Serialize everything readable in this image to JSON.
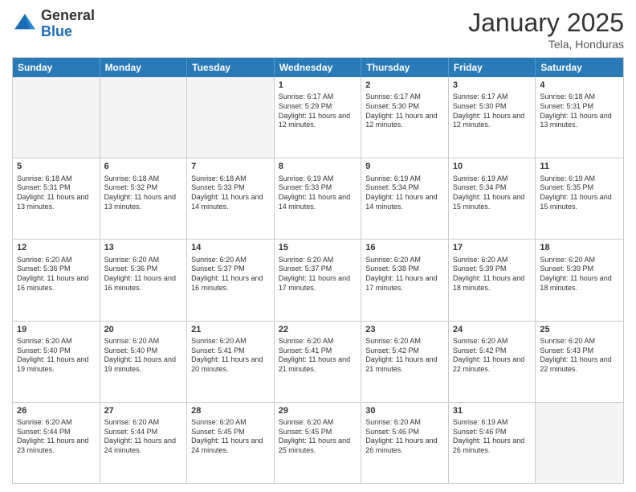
{
  "logo": {
    "general": "General",
    "blue": "Blue"
  },
  "title": "January 2025",
  "location": "Tela, Honduras",
  "days": [
    "Sunday",
    "Monday",
    "Tuesday",
    "Wednesday",
    "Thursday",
    "Friday",
    "Saturday"
  ],
  "weeks": [
    [
      {
        "day": "",
        "sunrise": "",
        "sunset": "",
        "daylight": "",
        "empty": true
      },
      {
        "day": "",
        "sunrise": "",
        "sunset": "",
        "daylight": "",
        "empty": true
      },
      {
        "day": "",
        "sunrise": "",
        "sunset": "",
        "daylight": "",
        "empty": true
      },
      {
        "day": "1",
        "sunrise": "Sunrise: 6:17 AM",
        "sunset": "Sunset: 5:29 PM",
        "daylight": "Daylight: 11 hours and 12 minutes.",
        "empty": false
      },
      {
        "day": "2",
        "sunrise": "Sunrise: 6:17 AM",
        "sunset": "Sunset: 5:30 PM",
        "daylight": "Daylight: 11 hours and 12 minutes.",
        "empty": false
      },
      {
        "day": "3",
        "sunrise": "Sunrise: 6:17 AM",
        "sunset": "Sunset: 5:30 PM",
        "daylight": "Daylight: 11 hours and 12 minutes.",
        "empty": false
      },
      {
        "day": "4",
        "sunrise": "Sunrise: 6:18 AM",
        "sunset": "Sunset: 5:31 PM",
        "daylight": "Daylight: 11 hours and 13 minutes.",
        "empty": false
      }
    ],
    [
      {
        "day": "5",
        "sunrise": "Sunrise: 6:18 AM",
        "sunset": "Sunset: 5:31 PM",
        "daylight": "Daylight: 11 hours and 13 minutes.",
        "empty": false
      },
      {
        "day": "6",
        "sunrise": "Sunrise: 6:18 AM",
        "sunset": "Sunset: 5:32 PM",
        "daylight": "Daylight: 11 hours and 13 minutes.",
        "empty": false
      },
      {
        "day": "7",
        "sunrise": "Sunrise: 6:18 AM",
        "sunset": "Sunset: 5:33 PM",
        "daylight": "Daylight: 11 hours and 14 minutes.",
        "empty": false
      },
      {
        "day": "8",
        "sunrise": "Sunrise: 6:19 AM",
        "sunset": "Sunset: 5:33 PM",
        "daylight": "Daylight: 11 hours and 14 minutes.",
        "empty": false
      },
      {
        "day": "9",
        "sunrise": "Sunrise: 6:19 AM",
        "sunset": "Sunset: 5:34 PM",
        "daylight": "Daylight: 11 hours and 14 minutes.",
        "empty": false
      },
      {
        "day": "10",
        "sunrise": "Sunrise: 6:19 AM",
        "sunset": "Sunset: 5:34 PM",
        "daylight": "Daylight: 11 hours and 15 minutes.",
        "empty": false
      },
      {
        "day": "11",
        "sunrise": "Sunrise: 6:19 AM",
        "sunset": "Sunset: 5:35 PM",
        "daylight": "Daylight: 11 hours and 15 minutes.",
        "empty": false
      }
    ],
    [
      {
        "day": "12",
        "sunrise": "Sunrise: 6:20 AM",
        "sunset": "Sunset: 5:36 PM",
        "daylight": "Daylight: 11 hours and 16 minutes.",
        "empty": false
      },
      {
        "day": "13",
        "sunrise": "Sunrise: 6:20 AM",
        "sunset": "Sunset: 5:36 PM",
        "daylight": "Daylight: 11 hours and 16 minutes.",
        "empty": false
      },
      {
        "day": "14",
        "sunrise": "Sunrise: 6:20 AM",
        "sunset": "Sunset: 5:37 PM",
        "daylight": "Daylight: 11 hours and 16 minutes.",
        "empty": false
      },
      {
        "day": "15",
        "sunrise": "Sunrise: 6:20 AM",
        "sunset": "Sunset: 5:37 PM",
        "daylight": "Daylight: 11 hours and 17 minutes.",
        "empty": false
      },
      {
        "day": "16",
        "sunrise": "Sunrise: 6:20 AM",
        "sunset": "Sunset: 5:38 PM",
        "daylight": "Daylight: 11 hours and 17 minutes.",
        "empty": false
      },
      {
        "day": "17",
        "sunrise": "Sunrise: 6:20 AM",
        "sunset": "Sunset: 5:39 PM",
        "daylight": "Daylight: 11 hours and 18 minutes.",
        "empty": false
      },
      {
        "day": "18",
        "sunrise": "Sunrise: 6:20 AM",
        "sunset": "Sunset: 5:39 PM",
        "daylight": "Daylight: 11 hours and 18 minutes.",
        "empty": false
      }
    ],
    [
      {
        "day": "19",
        "sunrise": "Sunrise: 6:20 AM",
        "sunset": "Sunset: 5:40 PM",
        "daylight": "Daylight: 11 hours and 19 minutes.",
        "empty": false
      },
      {
        "day": "20",
        "sunrise": "Sunrise: 6:20 AM",
        "sunset": "Sunset: 5:40 PM",
        "daylight": "Daylight: 11 hours and 19 minutes.",
        "empty": false
      },
      {
        "day": "21",
        "sunrise": "Sunrise: 6:20 AM",
        "sunset": "Sunset: 5:41 PM",
        "daylight": "Daylight: 11 hours and 20 minutes.",
        "empty": false
      },
      {
        "day": "22",
        "sunrise": "Sunrise: 6:20 AM",
        "sunset": "Sunset: 5:41 PM",
        "daylight": "Daylight: 11 hours and 21 minutes.",
        "empty": false
      },
      {
        "day": "23",
        "sunrise": "Sunrise: 6:20 AM",
        "sunset": "Sunset: 5:42 PM",
        "daylight": "Daylight: 11 hours and 21 minutes.",
        "empty": false
      },
      {
        "day": "24",
        "sunrise": "Sunrise: 6:20 AM",
        "sunset": "Sunset: 5:42 PM",
        "daylight": "Daylight: 11 hours and 22 minutes.",
        "empty": false
      },
      {
        "day": "25",
        "sunrise": "Sunrise: 6:20 AM",
        "sunset": "Sunset: 5:43 PM",
        "daylight": "Daylight: 11 hours and 22 minutes.",
        "empty": false
      }
    ],
    [
      {
        "day": "26",
        "sunrise": "Sunrise: 6:20 AM",
        "sunset": "Sunset: 5:44 PM",
        "daylight": "Daylight: 11 hours and 23 minutes.",
        "empty": false
      },
      {
        "day": "27",
        "sunrise": "Sunrise: 6:20 AM",
        "sunset": "Sunset: 5:44 PM",
        "daylight": "Daylight: 11 hours and 24 minutes.",
        "empty": false
      },
      {
        "day": "28",
        "sunrise": "Sunrise: 6:20 AM",
        "sunset": "Sunset: 5:45 PM",
        "daylight": "Daylight: 11 hours and 24 minutes.",
        "empty": false
      },
      {
        "day": "29",
        "sunrise": "Sunrise: 6:20 AM",
        "sunset": "Sunset: 5:45 PM",
        "daylight": "Daylight: 11 hours and 25 minutes.",
        "empty": false
      },
      {
        "day": "30",
        "sunrise": "Sunrise: 6:20 AM",
        "sunset": "Sunset: 5:46 PM",
        "daylight": "Daylight: 11 hours and 26 minutes.",
        "empty": false
      },
      {
        "day": "31",
        "sunrise": "Sunrise: 6:19 AM",
        "sunset": "Sunset: 5:46 PM",
        "daylight": "Daylight: 11 hours and 26 minutes.",
        "empty": false
      },
      {
        "day": "",
        "sunrise": "",
        "sunset": "",
        "daylight": "",
        "empty": true
      }
    ]
  ]
}
